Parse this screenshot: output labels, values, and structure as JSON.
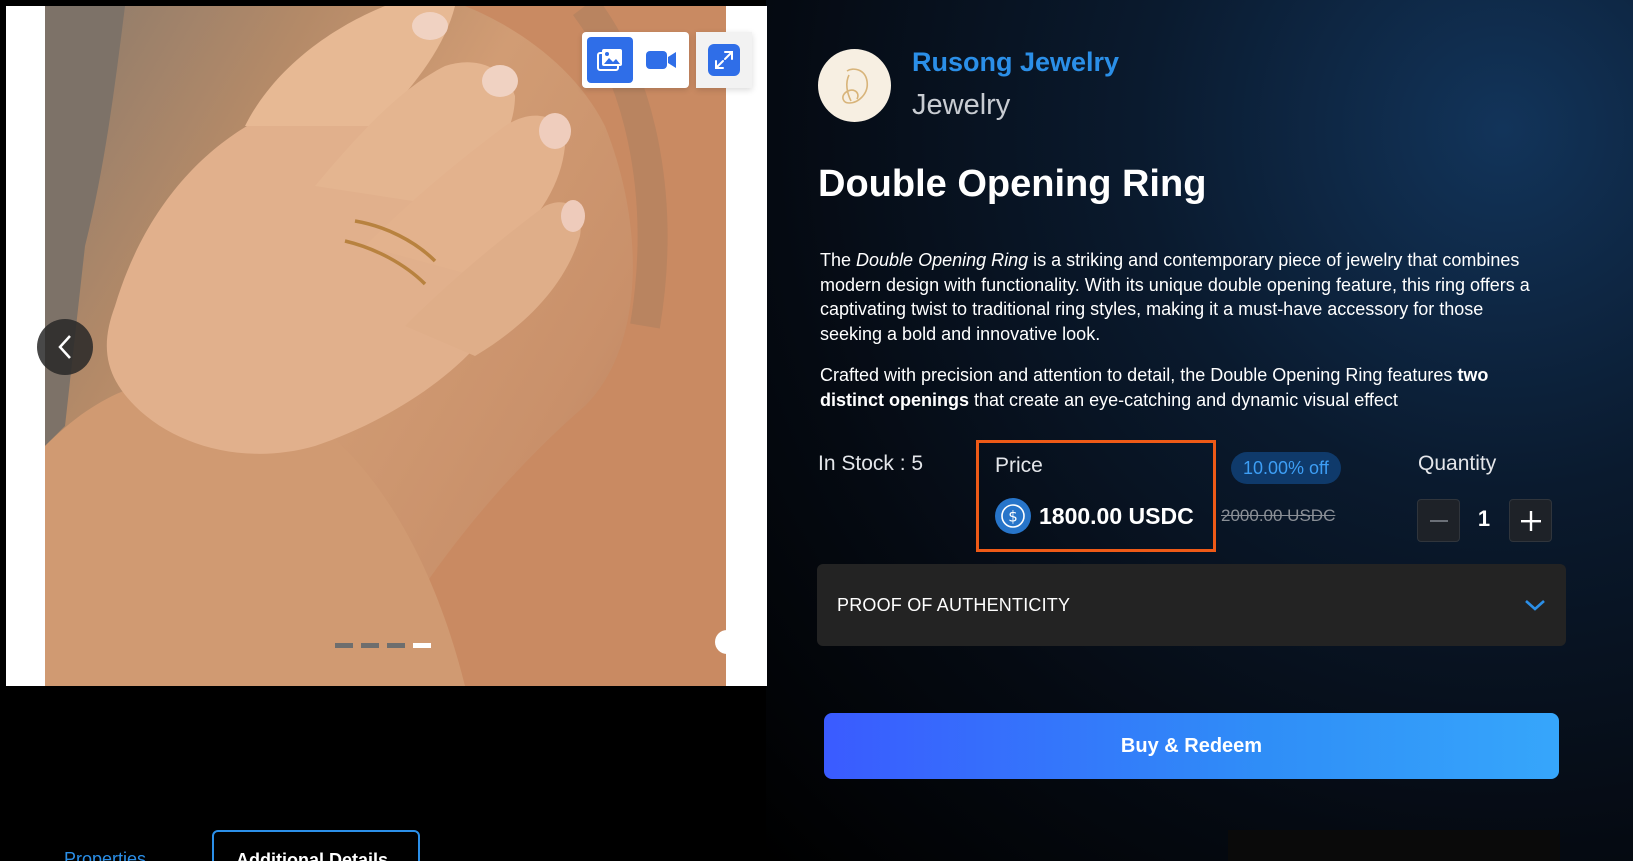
{
  "gallery": {
    "media_tabs": [
      "image-icon",
      "video-icon"
    ],
    "expand_icon": "expand-icon",
    "prev_icon": "chevron-left-icon",
    "slide_count": 4,
    "active_slide": 4
  },
  "merchant": {
    "name": "Rusong Jewelry",
    "category": "Jewelry",
    "logo_icon": "merchant-logo"
  },
  "product": {
    "title": "Double Opening Ring",
    "desc1_pre": "The ",
    "desc1_em": "Double Opening Ring",
    "desc1_post": " is a striking and contemporary piece of jewelry that combines modern design with functionality. With its unique double opening feature, this ring offers a captivating twist to traditional ring styles, making it a must-have accessory for those seeking a bold and innovative look.",
    "desc2_pre": "Crafted with precision and attention to detail, the Double Opening Ring features ",
    "desc2_strong": "two distinct openings",
    "desc2_post": " that create an eye-catching and dynamic visual effect"
  },
  "stock": {
    "label": "In Stock : 5"
  },
  "price": {
    "label": "Price",
    "value": "1800.00 USDC",
    "original": "2000.00 USDC",
    "discount": "10.00% off",
    "currency_icon": "usdc-icon",
    "highlight_color": "#ee5a17"
  },
  "quantity": {
    "label": "Quantity",
    "value": "1"
  },
  "accordion": {
    "title": "PROOF OF AUTHENTICITY"
  },
  "buy_button": {
    "label": "Buy & Redeem"
  },
  "tabs": {
    "properties": "Properties",
    "additional": "Additional Details"
  },
  "colors": {
    "accent": "#2b8fe8",
    "button_start": "#3a5bff",
    "button_end": "#36a6fb"
  }
}
